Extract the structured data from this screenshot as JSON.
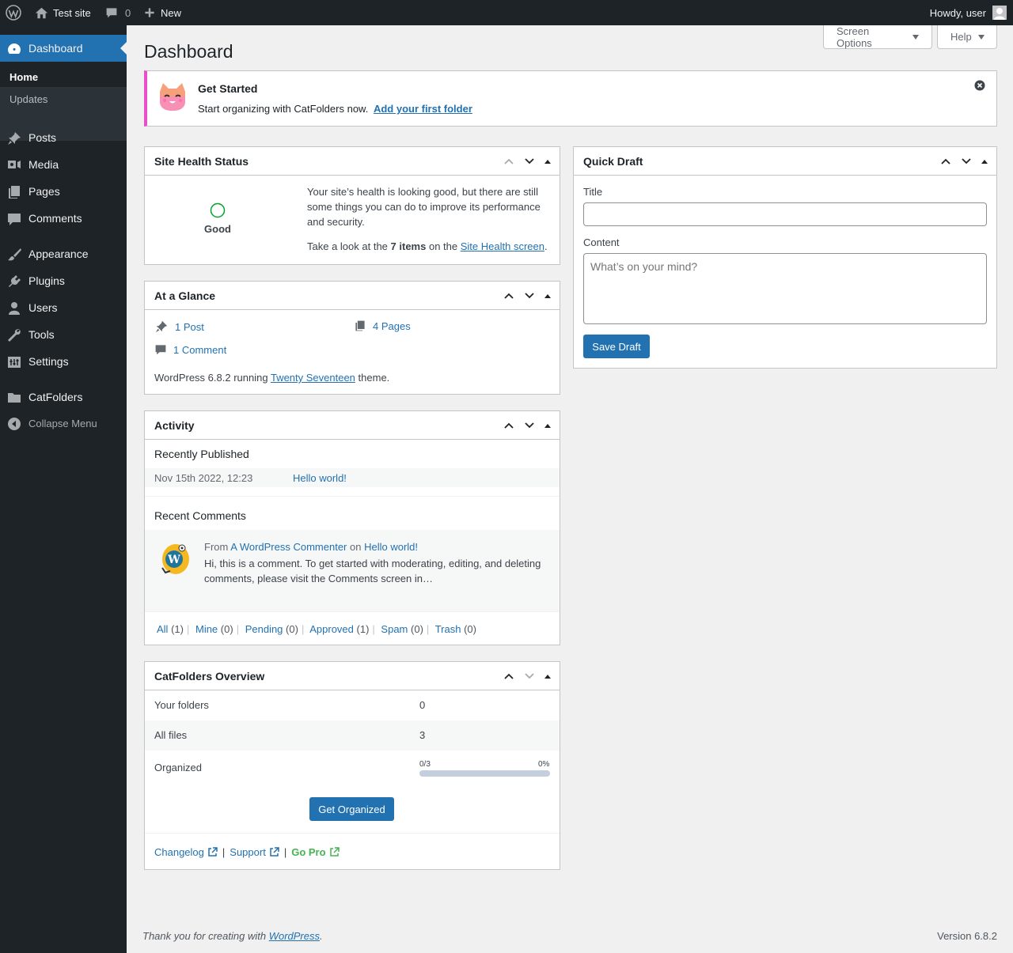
{
  "adminbar": {
    "site_name": "Test site",
    "comments_count": "0",
    "new_label": "New",
    "howdy": "Howdy, user"
  },
  "sidebar": {
    "dashboard": "Dashboard",
    "submenu": [
      "Home",
      "Updates"
    ],
    "items": [
      "Posts",
      "Media",
      "Pages",
      "Comments",
      "Appearance",
      "Plugins",
      "Users",
      "Tools",
      "Settings",
      "CatFolders"
    ],
    "collapse": "Collapse Menu"
  },
  "header": {
    "title": "Dashboard",
    "screen_options": "Screen Options",
    "help": "Help"
  },
  "notice": {
    "title": "Get Started",
    "text": "Start organizing with CatFolders now.",
    "link": "Add your first folder"
  },
  "site_health": {
    "title": "Site Health Status",
    "status": "Good",
    "desc": "Your site’s health is looking good, but there are still some things you can do to improve its performance and security.",
    "look_prefix": "Take a look at the",
    "items_count": "7 items",
    "look_mid": "on the",
    "screen_link": "Site Health screen",
    "period": "."
  },
  "glance": {
    "title": "At a Glance",
    "posts": "1 Post",
    "pages": "4 Pages",
    "comments": "1 Comment",
    "version_prefix": "WordPress 6.8.2 running",
    "theme": "Twenty Seventeen",
    "version_suffix": "theme."
  },
  "activity": {
    "title": "Activity",
    "recently_published": "Recently Published",
    "post_date": "Nov 15th 2022, 12:23",
    "post_title": "Hello world!",
    "recent_comments": "Recent Comments",
    "from": "From",
    "commenter": "A WordPress Commenter",
    "on": "on",
    "comment_post": "Hello world!",
    "comment_text": "Hi, this is a comment. To get started with moderating, editing, and deleting comments, please visit the Comments screen in…",
    "filters": [
      {
        "label": "All",
        "count": "(1)"
      },
      {
        "label": "Mine",
        "count": "(0)"
      },
      {
        "label": "Pending",
        "count": "(0)"
      },
      {
        "label": "Approved",
        "count": "(1)"
      },
      {
        "label": "Spam",
        "count": "(0)"
      },
      {
        "label": "Trash",
        "count": "(0)"
      }
    ]
  },
  "catfolders": {
    "title": "CatFolders Overview",
    "your_folders_label": "Your folders",
    "your_folders_value": "0",
    "all_files_label": "All files",
    "all_files_value": "3",
    "organized_label": "Organized",
    "organized_fraction": "0/3",
    "organized_percent": "0%",
    "organized_progress": 0,
    "button": "Get Organized",
    "changelog": "Changelog",
    "support": "Support",
    "go_pro": "Go Pro",
    "pipe": "|"
  },
  "quick_draft": {
    "title": "Quick Draft",
    "title_label": "Title",
    "title_value": "",
    "content_label": "Content",
    "content_placeholder": "What’s on your mind?",
    "save": "Save Draft"
  },
  "footer": {
    "thanks_prefix": "Thank you for creating with",
    "wp_link": "WordPress",
    "thanks_suffix": ".",
    "version": "Version 6.8.2"
  },
  "colors": {
    "accent": "#2271b1",
    "sidebar_bg": "#1d2327",
    "good": "#00a32a",
    "notice_border": "#e84fc8",
    "go_pro": "#46b450"
  }
}
